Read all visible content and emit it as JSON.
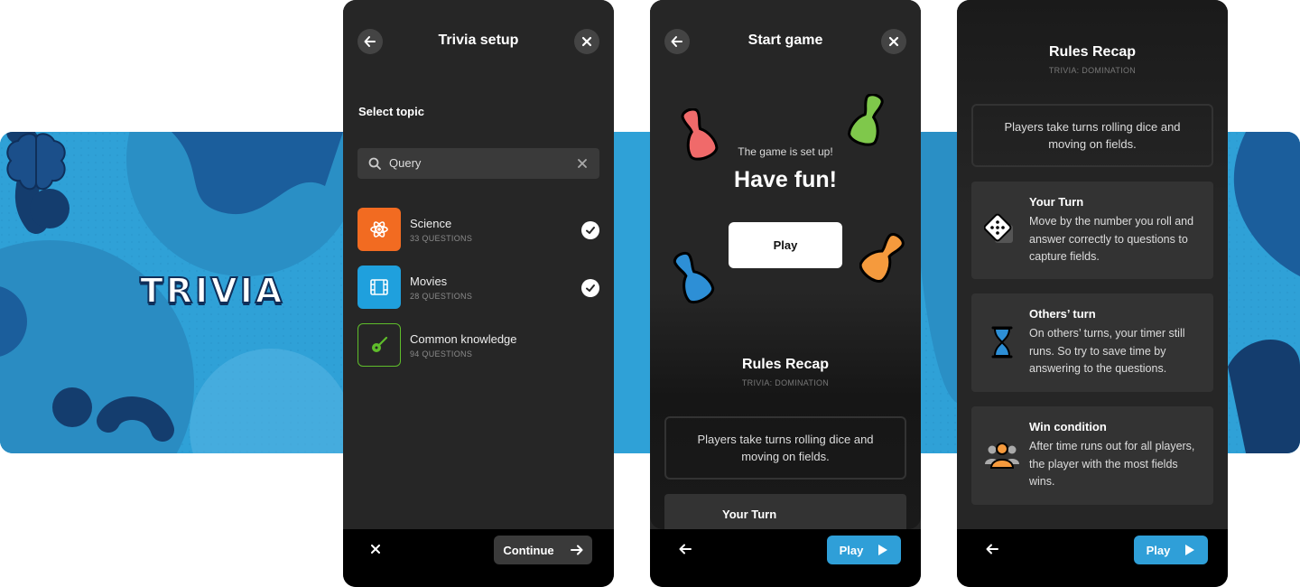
{
  "brand": {
    "logo_text": "TRIVIA"
  },
  "setup": {
    "title": "Trivia setup",
    "select_label": "Select topic",
    "search": {
      "value": "Query",
      "placeholder": "Query"
    },
    "topics": [
      {
        "name": "Science",
        "count": "33 QUESTIONS",
        "icon": "atom-icon",
        "color": "#f26b21",
        "selected": true
      },
      {
        "name": "Movies",
        "count": "28 QUESTIONS",
        "icon": "film-icon",
        "color": "#1fa0dd",
        "selected": true
      },
      {
        "name": "Common knowledge",
        "count": "94 QUESTIONS",
        "icon": "guitar-icon",
        "color": "#5fbd2b",
        "selected": false
      }
    ],
    "continue_label": "Continue"
  },
  "start": {
    "title": "Start game",
    "setup_message": "The game is set up!",
    "have_fun": "Have fun!",
    "play_label": "Play"
  },
  "rules": {
    "title": "Rules Recap",
    "subtitle": "TRIVIA: DOMINATION",
    "intro": "Players take turns rolling dice and moving on fields.",
    "items": [
      {
        "title": "Your Turn",
        "text": "Move by the number you roll and answer correctly to questions to capture fields.",
        "icon": "dice-icon"
      },
      {
        "title": "Others’ turn",
        "text": "On others’ turns, your timer still runs. So try to save time by answering to the questions.",
        "icon": "hourglass-icon"
      },
      {
        "title": "Win condition",
        "text": "After time runs out for all players, the player with the most fields wins.",
        "icon": "players-icon"
      }
    ]
  },
  "bottom": {
    "play_label": "Play"
  },
  "colors": {
    "accent_blue": "#2f9fd8",
    "dark_bg": "#262626",
    "banner_blue": "#2fa1d7"
  }
}
